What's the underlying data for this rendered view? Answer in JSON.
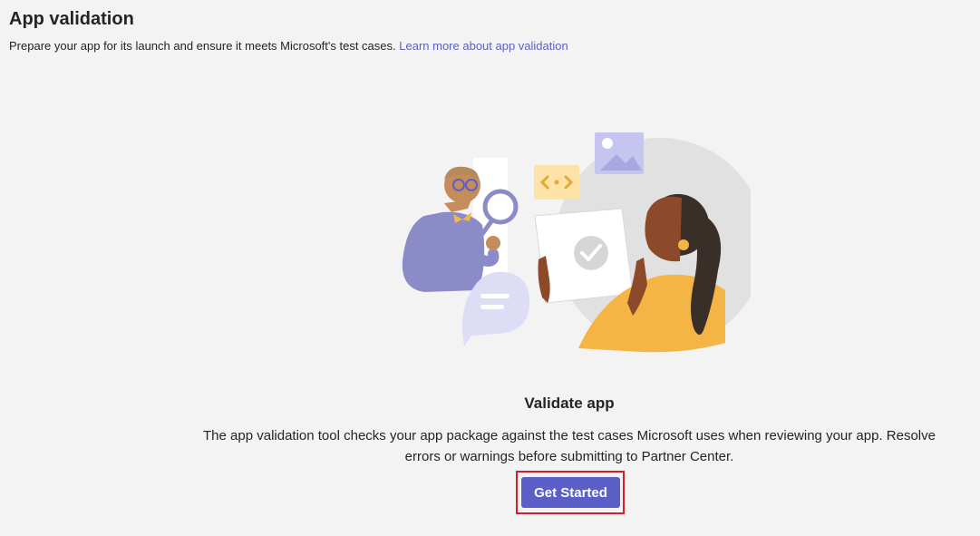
{
  "header": {
    "title": "App validation",
    "subtitle": "Prepare your app for its launch and ensure it meets Microsoft's test cases.",
    "learn_more_link": "Learn more about app validation"
  },
  "main": {
    "illustration_name": "app-validation-illustration",
    "section_title": "Validate app",
    "description_line1": "The app validation tool checks your app package against the test cases Microsoft uses when reviewing your app. Resolve",
    "description_line2": "errors or warnings before submitting to Partner Center.",
    "primary_button": "Get Started"
  },
  "colors": {
    "background": "#f3f3f3",
    "text": "#242424",
    "link": "#5b5fc7",
    "button": "#5b5fc7",
    "highlight_border": "#d4202c"
  }
}
